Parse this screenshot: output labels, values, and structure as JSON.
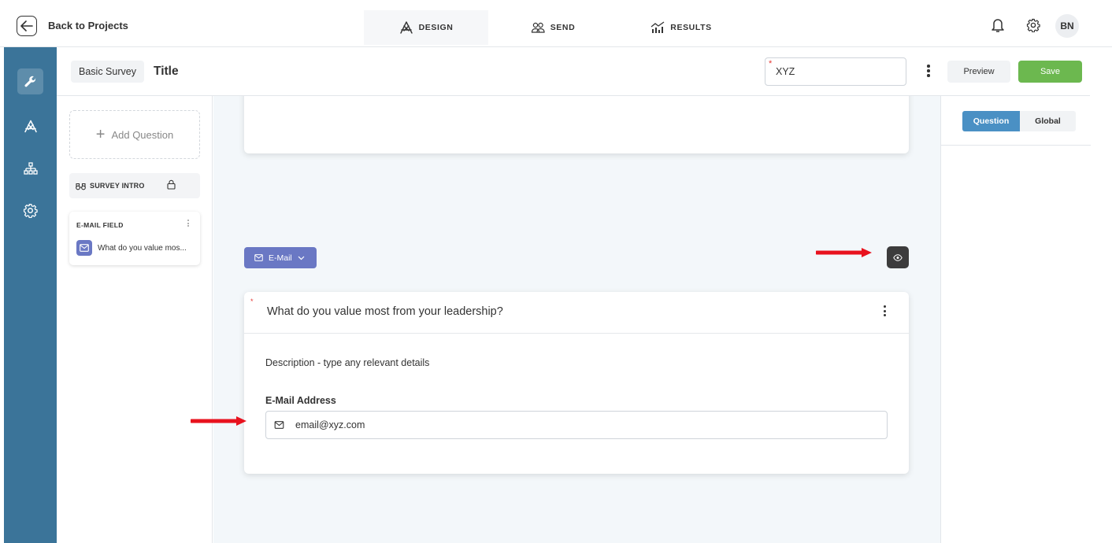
{
  "header": {
    "back_label": "Back to Projects",
    "tabs": [
      {
        "label": "DESIGN",
        "icon": "design-icon",
        "active": true
      },
      {
        "label": "SEND",
        "icon": "users-icon",
        "active": false
      },
      {
        "label": "RESULTS",
        "icon": "chart-icon",
        "active": false
      }
    ],
    "avatar_initials": "BN"
  },
  "sidebar": {
    "items": [
      {
        "icon": "wrench-icon",
        "active": true
      },
      {
        "icon": "design-icon",
        "active": false
      },
      {
        "icon": "hierarchy-icon",
        "active": false
      },
      {
        "icon": "gear-icon",
        "active": false
      }
    ]
  },
  "subheader": {
    "survey_type": "Basic Survey",
    "title": "Title",
    "name_value": "XYZ",
    "preview_label": "Preview",
    "save_label": "Save"
  },
  "question_list": {
    "add_label": "Add Question",
    "intro_label": "SURVEY INTRO",
    "cards": [
      {
        "type_label": "E-MAIL FIELD",
        "text": "What do you value mos..."
      }
    ]
  },
  "editor": {
    "type_select_label": "E-Mail",
    "question_title": "What do you value most from your leadership?",
    "description": "Description - type any relevant details",
    "field_label": "E-Mail Address",
    "field_placeholder": "email@xyz.com"
  },
  "right_panel": {
    "tabs": [
      {
        "label": "Question",
        "active": true
      },
      {
        "label": "Global",
        "active": false
      }
    ]
  },
  "colors": {
    "sidebar_bg": "#3b7499",
    "accent_purple": "#6a78c4",
    "save_green": "#6cb84f",
    "active_tab_blue": "#4a90c4",
    "annotation_red": "#e8121e"
  }
}
